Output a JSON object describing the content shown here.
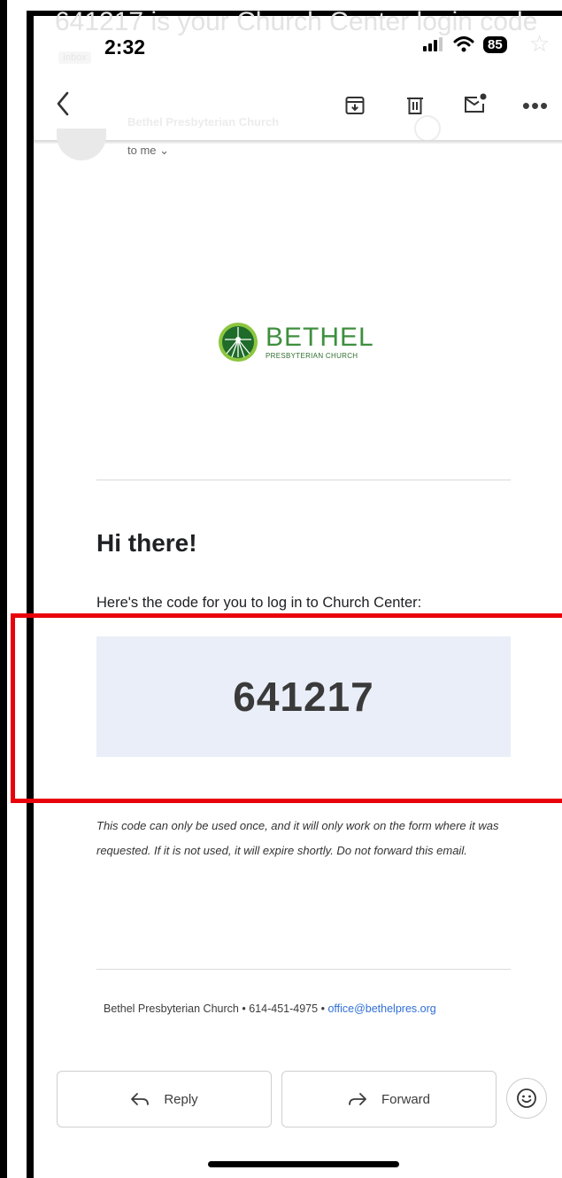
{
  "ghost": {
    "subject": "641217 is your Church Center login code",
    "inbox_badge": "Inbox",
    "sender": "Bethel Presbyterian Church"
  },
  "status_bar": {
    "time": "2:32",
    "battery": "85",
    "icons": [
      "signal-icon",
      "wifi-icon",
      "battery-icon"
    ]
  },
  "toolbar": {
    "icons": [
      "back-chevron-icon",
      "archive-icon",
      "trash-icon",
      "mark-unread-icon",
      "more-icon"
    ],
    "more_label": "•••"
  },
  "email_header": {
    "recipient": "to me"
  },
  "email": {
    "logo": {
      "name": "BETHEL",
      "subtitle": "PRESBYTERIAN CHURCH",
      "color": "#3e8f3e"
    },
    "greeting": "Hi there!",
    "intro": "Here's the code for you to log in to Church Center:",
    "code": "641217",
    "note": "This code can only be used once, and it will only work on the form where it was requested. If it is not used, it will expire shortly. Do not forward this email.",
    "footer": {
      "organization": "Bethel Presbyterian Church",
      "separator": "•",
      "phone": "614-451-4975",
      "email": "office@bethelpres.org"
    }
  },
  "actions": {
    "reply": "Reply",
    "forward": "Forward"
  },
  "colors": {
    "highlight": "#e8000b",
    "code_background": "#e9eef8",
    "link": "#2f6fd8"
  }
}
